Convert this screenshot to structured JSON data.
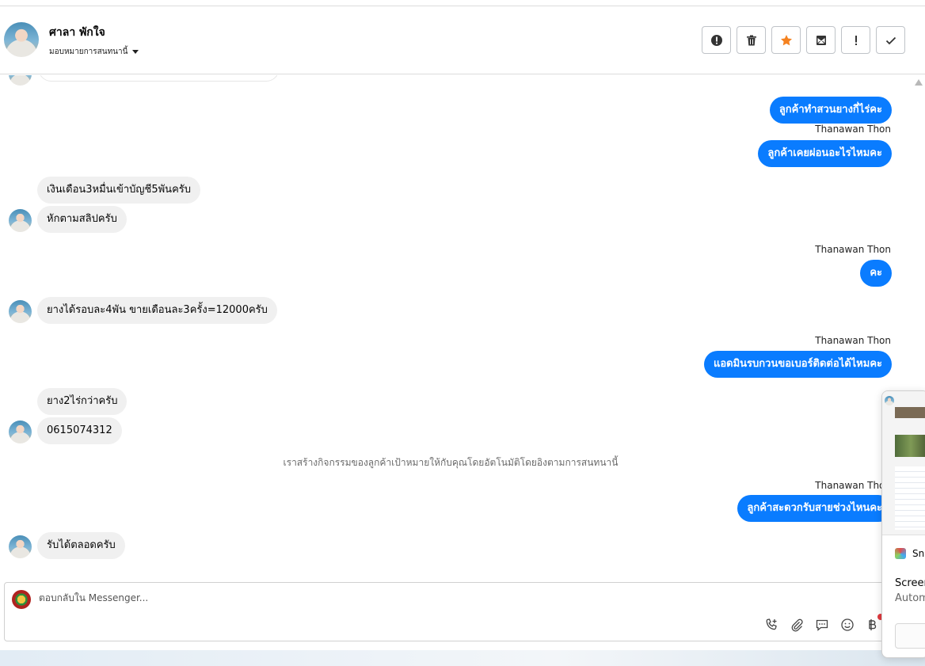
{
  "header": {
    "contact_name": "ศาลา พักใจ",
    "assign_label": "มอบหมายการสนทนานี้"
  },
  "actions": [
    {
      "name": "spam-button",
      "icon": "exclamation-circle-icon"
    },
    {
      "name": "delete-button",
      "icon": "trash-icon"
    },
    {
      "name": "star-button",
      "icon": "star-icon",
      "color": "#f58220"
    },
    {
      "name": "mark-unread-button",
      "icon": "mail-icon"
    },
    {
      "name": "follow-up-button",
      "icon": "exclamation-icon"
    },
    {
      "name": "done-button",
      "icon": "check-icon"
    }
  ],
  "messages": [
    {
      "side": "out",
      "text": "ลูกค้าทำสวนยางกี่ไร่คะ"
    },
    {
      "side": "out",
      "sender": "Thanawan Thon",
      "text": "ลูกค้าเคยผ่อนอะไรไหมคะ"
    },
    {
      "side": "in",
      "text": "เงินเดือน3หมื่นเข้าบัญชี5พันครับ"
    },
    {
      "side": "in",
      "text": "หักตามสลิปครับ"
    },
    {
      "side": "out",
      "sender": "Thanawan Thon",
      "text": "คะ"
    },
    {
      "side": "in",
      "text": "ยางได้รอบละ4พัน ขายเดือนละ3ครั้ง=12000ครับ"
    },
    {
      "side": "out",
      "sender": "Thanawan Thon",
      "text": "แอดมินรบกวนขอเบอร์ติดต่อได้ไหมคะ"
    },
    {
      "side": "in",
      "text": "ยาง2ไร่กว่าครับ"
    },
    {
      "side": "in",
      "text": "0615074312"
    },
    {
      "side": "out",
      "sender": "Thanawan Thon",
      "text": "ลูกค้าสะดวกรับสายช่วงไหนคะ"
    },
    {
      "side": "in",
      "text": "รับได้ตลอดครับ"
    }
  ],
  "system_note": "เราสร้างกิจกรรมของลูกค้าเป้าหมายให้กับคุณโดยอัตโนมัติโดยอิงตามการสนทนานี้",
  "composer": {
    "placeholder": "ตอบกลับใน Messenger...",
    "tools": [
      "phone-add-icon",
      "paperclip-icon",
      "saved-reply-icon",
      "emoji-icon",
      "baht-icon"
    ]
  },
  "popup": {
    "app_label": "Sni",
    "line1": "Screen",
    "line2": "Autom"
  }
}
